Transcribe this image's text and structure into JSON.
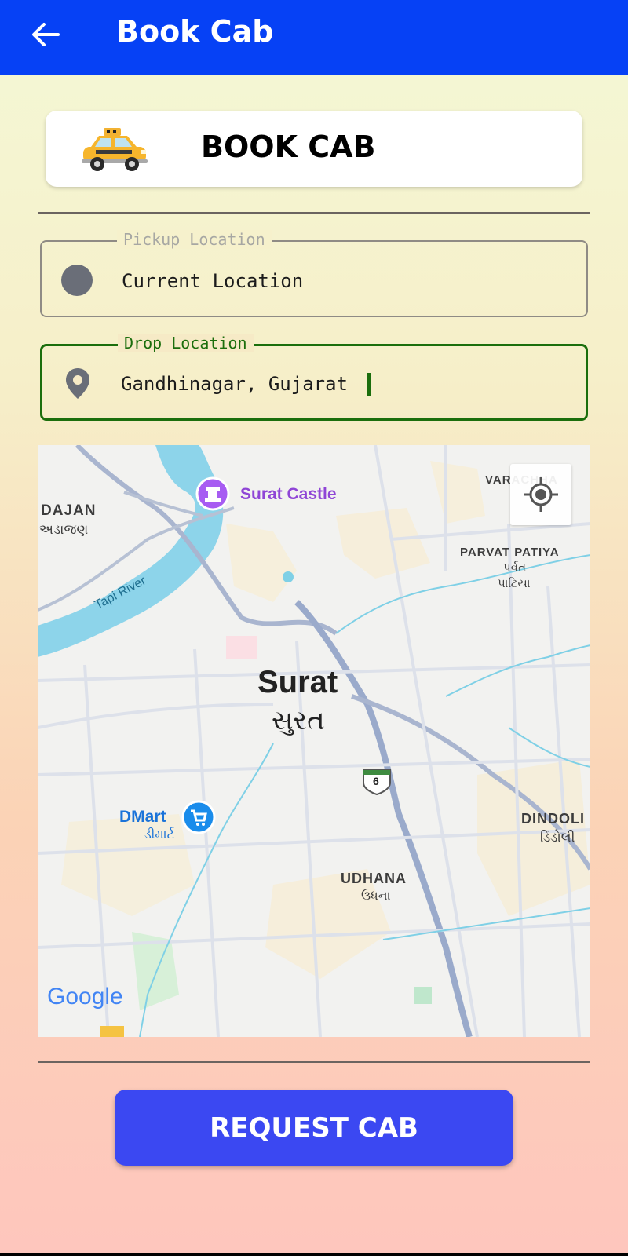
{
  "appbar": {
    "title": "Book Cab",
    "back_icon": "arrow-left-icon",
    "color": "#0641f5"
  },
  "header_card": {
    "title": "BOOK CAB",
    "icon": "taxi-icon"
  },
  "pickup": {
    "label": "Pickup Location",
    "value": "Current Location",
    "icon": "circle-dot-icon"
  },
  "drop": {
    "label": "Drop Location",
    "value": "Gandhinagar, Gujarat",
    "icon": "map-pin-icon",
    "accent": "#1b6e0c"
  },
  "map": {
    "labels": {
      "surat": "Surat",
      "surat_gu": "સુરત",
      "surat_castle": "Surat Castle",
      "dajan": "DAJAN",
      "dajan_gu": "અડાજણ",
      "tapi_river": "Tapi River",
      "varachha": "VARACHHA",
      "parvat_patiya": "PARVAT PATIYA",
      "parvat_gu_1": "પર્વત",
      "parvat_gu_2": "પાટિયા",
      "dmart": "DMart",
      "dmart_gu": "ડીમાર્ટ",
      "dindoli": "DINDOLI",
      "dindoli_gu": "ડિંડોલી",
      "udhana": "UDHANA",
      "udhana_gu": "ઉધના",
      "highway": "6",
      "google": "Google"
    },
    "locate_icon": "my-location-icon"
  },
  "request_button": {
    "label": "REQUEST CAB",
    "color": "#3b48f2"
  }
}
